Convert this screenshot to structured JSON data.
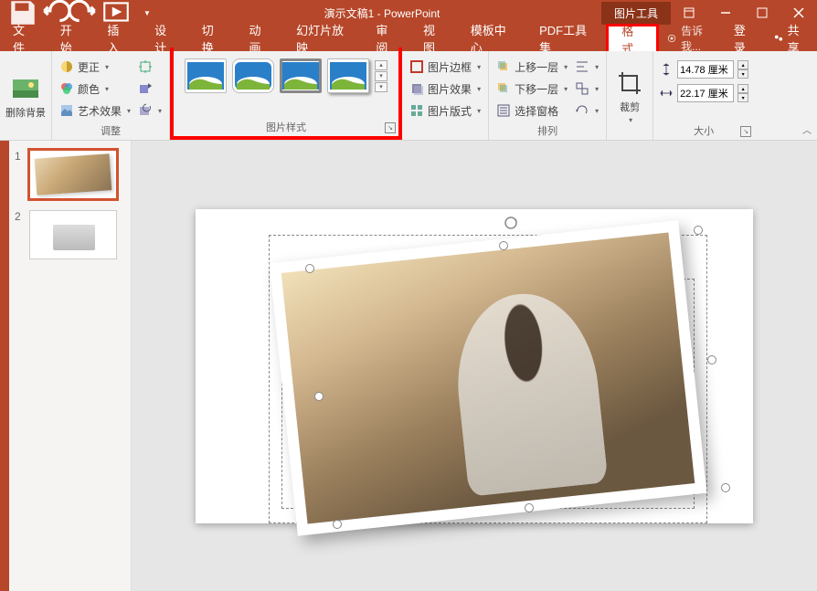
{
  "title": "演示文稿1 - PowerPoint",
  "context_tool": "图片工具",
  "menu": {
    "file": "文件",
    "home": "开始",
    "insert": "插入",
    "design": "设计",
    "transition": "切换",
    "animation": "动画",
    "slideshow": "幻灯片放映",
    "review": "审阅",
    "view": "视图",
    "template": "模板中心",
    "pdf": "PDF工具集",
    "format": "格式",
    "tellme": "告诉我...",
    "login": "登录",
    "share": "共享"
  },
  "ribbon": {
    "remove_bg": "删除背景",
    "corrections": "更正",
    "color": "颜色",
    "artistic": "艺术效果",
    "adjust_label": "调整",
    "styles_label": "图片样式",
    "pic_border": "图片边框",
    "pic_effects": "图片效果",
    "pic_layout": "图片版式",
    "bring_forward": "上移一层",
    "send_backward": "下移一层",
    "selection_pane": "选择窗格",
    "arrange_label": "排列",
    "crop": "裁剪",
    "height_val": "14.78 厘米",
    "width_val": "22.17 厘米",
    "size_label": "大小"
  },
  "thumbs": {
    "n1": "1",
    "n2": "2"
  }
}
